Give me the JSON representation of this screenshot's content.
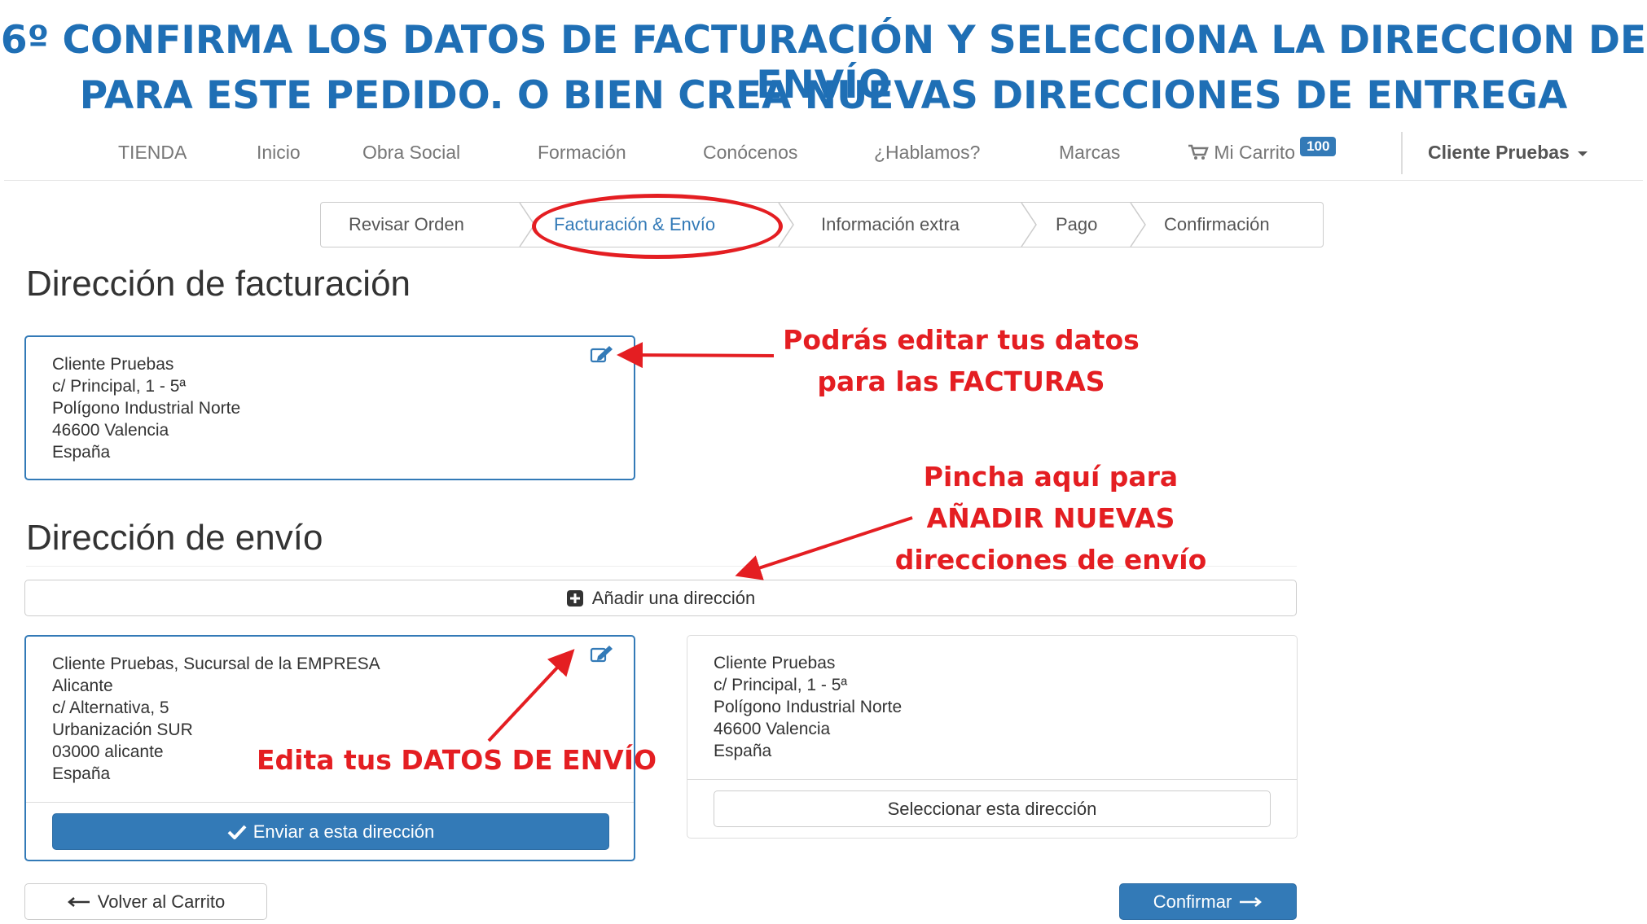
{
  "banner": {
    "line1": "6º CONFIRMA LOS DATOS DE FACTURACIÓN Y SELECCIONA LA DIRECCION DE ENVÍO",
    "line2": "PARA ESTE PEDIDO. O BIEN CREA NUEVAS DIRECCIONES DE ENTREGA"
  },
  "nav": {
    "items": [
      "TIENDA",
      "Inicio",
      "Obra Social",
      "Formación",
      "Conócenos",
      "¿Hablamos?",
      "Marcas"
    ],
    "cart_label": "Mi Carrito",
    "cart_badge": "100",
    "user_label": "Cliente Pruebas"
  },
  "steps": [
    "Revisar Orden",
    "Facturación & Envío",
    "Información extra",
    "Pago",
    "Confirmación"
  ],
  "billing": {
    "title": "Dirección de facturación",
    "lines": [
      "Cliente Pruebas",
      "c/ Principal, 1 - 5ª",
      "Polígono Industrial Norte",
      "46600 Valencia",
      "España"
    ]
  },
  "shipping": {
    "title": "Dirección de envío",
    "add_button": "Añadir una dirección",
    "address1": {
      "lines": [
        "Cliente Pruebas, Sucursal de la EMPRESA",
        "Alicante",
        "c/ Alternativa, 5",
        "Urbanización SUR",
        "03000 alicante",
        "España"
      ],
      "button": "Enviar a esta dirección"
    },
    "address2": {
      "lines": [
        "Cliente Pruebas",
        "c/ Principal, 1 - 5ª",
        "Polígono Industrial Norte",
        "46600 Valencia",
        "España"
      ],
      "button": "Seleccionar esta dirección"
    }
  },
  "footer": {
    "back_button": "Volver al Carrito",
    "confirm_button": "Confirmar"
  },
  "annotations": {
    "billing_note": [
      "Podrás editar tus datos",
      "para las FACTURAS"
    ],
    "add_note": [
      "Pincha aquí para",
      "AÑADIR NUEVAS",
      "direcciones de envío"
    ],
    "edit_note": "Edita tus DATOS DE ENVÍO"
  },
  "colors": {
    "banner": "#1f6fb5",
    "primary": "#337ab7",
    "annotation": "#e41e22"
  }
}
